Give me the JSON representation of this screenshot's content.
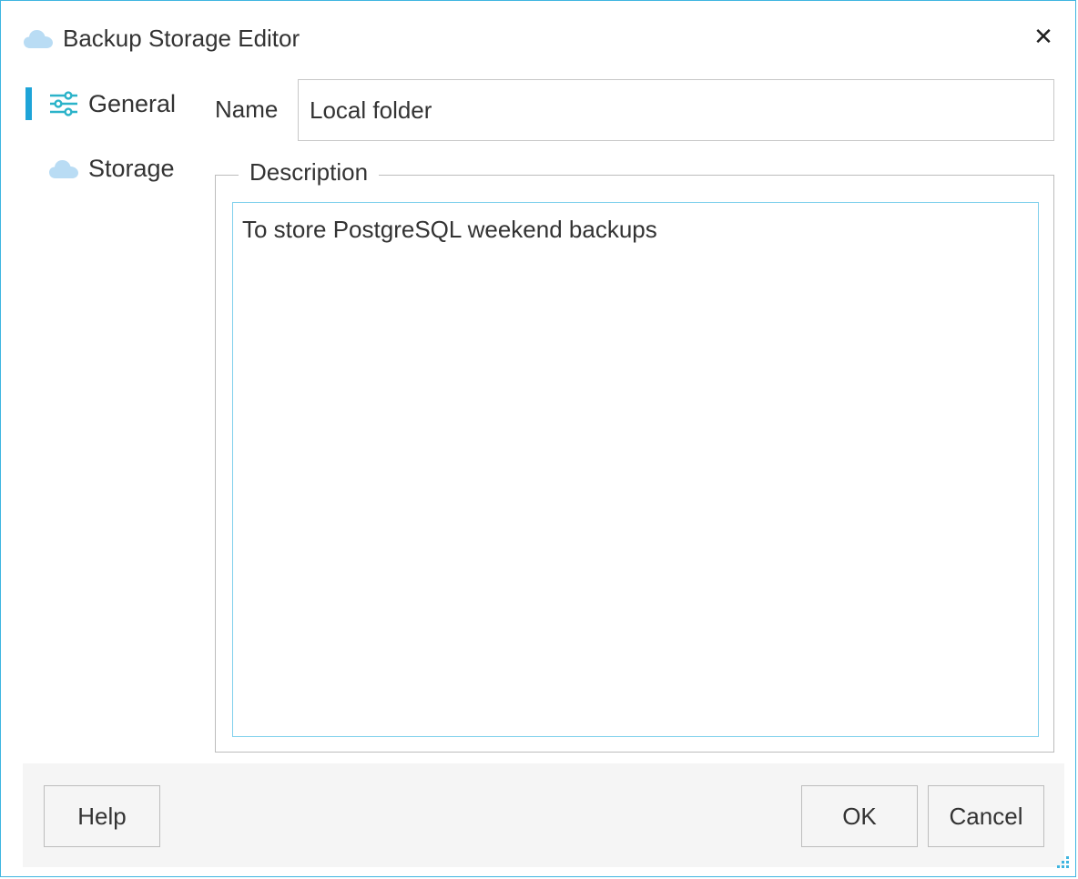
{
  "window": {
    "title": "Backup Storage Editor",
    "close_glyph": "✕",
    "title_icon": "cloud-icon",
    "accent_color": "#1ea4d8",
    "border_color": "#3fb5e0"
  },
  "nav": {
    "items": [
      {
        "label": "General",
        "icon": "sliders-icon",
        "selected": true
      },
      {
        "label": "Storage",
        "icon": "cloud-icon",
        "selected": false
      }
    ]
  },
  "form": {
    "name_label": "Name",
    "name_value": "Local folder",
    "description_legend": "Description",
    "description_value": "To store PostgreSQL weekend backups"
  },
  "footer": {
    "help_label": "Help",
    "ok_label": "OK",
    "cancel_label": "Cancel"
  }
}
